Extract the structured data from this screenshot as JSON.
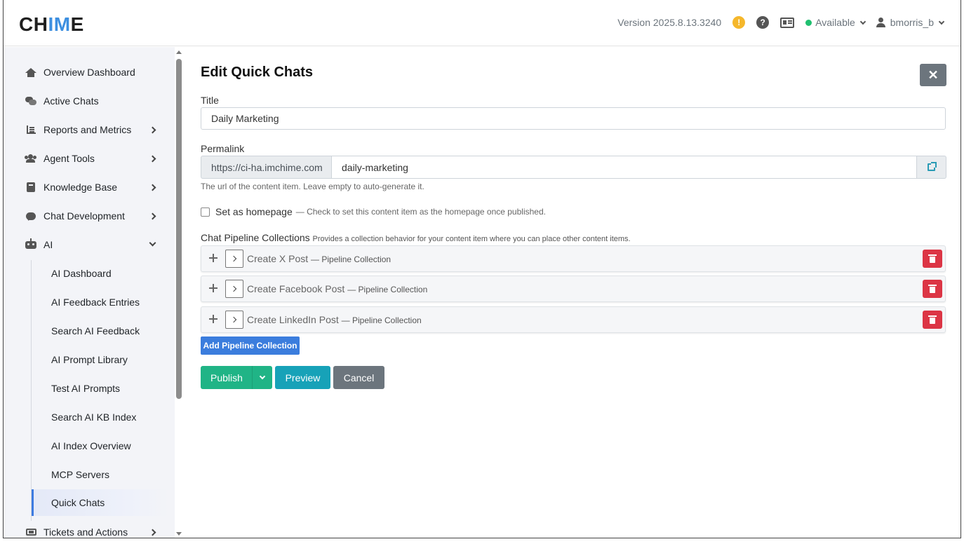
{
  "header": {
    "logo_prefix": "CH",
    "logo_accent": "IM",
    "logo_suffix": "E",
    "version": "Version 2025.8.13.3240",
    "status": "Available",
    "username": "bmorris_b"
  },
  "sidebar": {
    "items": [
      {
        "label": "Overview Dashboard",
        "icon": "home-icon"
      },
      {
        "label": "Active Chats",
        "icon": "comments-icon"
      },
      {
        "label": "Reports and Metrics",
        "icon": "chart-icon"
      },
      {
        "label": "Agent Tools",
        "icon": "users-icon"
      },
      {
        "label": "Knowledge Base",
        "icon": "book-icon"
      },
      {
        "label": "Chat Development",
        "icon": "comment-icon"
      },
      {
        "label": "AI",
        "icon": "robot-icon"
      },
      {
        "label": "Tickets and Actions",
        "icon": "ticket-icon"
      }
    ],
    "ai_subitems": [
      "AI Dashboard",
      "AI Feedback Entries",
      "Search AI Feedback",
      "AI Prompt Library",
      "Test AI Prompts",
      "Search AI KB Index",
      "AI Index Overview",
      "MCP Servers",
      "Quick Chats"
    ],
    "active_subitem": "Quick Chats"
  },
  "form": {
    "page_title": "Edit Quick Chats",
    "close_label": "✕",
    "title_label": "Title",
    "title_value": "Daily Marketing",
    "permalink_label": "Permalink",
    "permalink_prefix": "https://ci-ha.imchime.com",
    "permalink_value": "daily-marketing",
    "permalink_help": "The url of the content item. Leave empty to auto-generate it.",
    "homepage_label": "Set as homepage",
    "homepage_help": "— Check to set this content item as the homepage once published.",
    "collections_label": "Chat Pipeline Collections",
    "collections_help": "Provides a collection behavior for your content item where you can place other content items.",
    "collections": [
      {
        "title": "Create X Post",
        "type": "— Pipeline Collection"
      },
      {
        "title": "Create Facebook Post",
        "type": "— Pipeline Collection"
      },
      {
        "title": "Create LinkedIn Post",
        "type": "— Pipeline Collection"
      }
    ],
    "add_collection_label": "Add Pipeline Collection",
    "publish_label": "Publish",
    "preview_label": "Preview",
    "cancel_label": "Cancel"
  },
  "colors": {
    "accent_blue": "#3d8fe0",
    "publish_green": "#20b486",
    "preview_teal": "#17a2b8",
    "danger_red": "#dc3545",
    "status_green": "#20c070"
  }
}
